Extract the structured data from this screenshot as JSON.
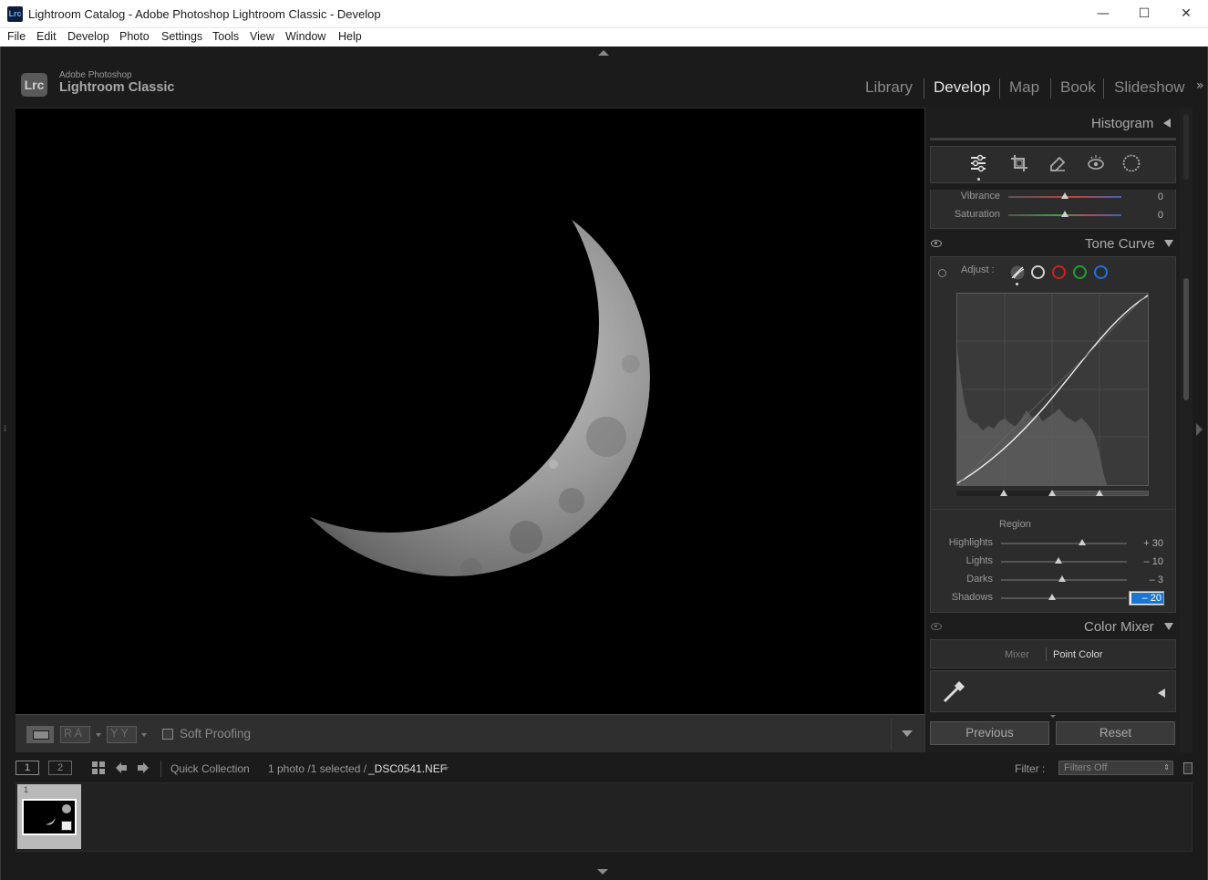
{
  "window": {
    "title": "Lightroom Catalog - Adobe Photoshop Lightroom Classic - Develop",
    "app_icon": "Lrc",
    "minimize": "—",
    "maximize": "☐",
    "close": "✕"
  },
  "menu": [
    "File",
    "Edit",
    "Develop",
    "Photo",
    "Settings",
    "Tools",
    "View",
    "Window",
    "Help"
  ],
  "identity": {
    "badge": "Lrc",
    "brand_top": "Adobe Photoshop",
    "brand_main": "Lightroom Classic"
  },
  "modules": [
    "Library",
    "Develop",
    "Map",
    "Book",
    "Slideshow"
  ],
  "active_module": "Develop",
  "toolbar": {
    "ra_label": "R A",
    "yy_label": "Y Y",
    "soft_proofing": "Soft Proofing"
  },
  "panels": {
    "histogram": "Histogram",
    "tone_curve": "Tone Curve",
    "color_mixer": "Color Mixer"
  },
  "tools": [
    "edit-sliders-icon",
    "crop-icon",
    "healing-icon",
    "red-eye-icon",
    "masking-icon"
  ],
  "basic_tail": [
    {
      "label": "Vibrance",
      "value": "0",
      "position": 0.5
    },
    {
      "label": "Saturation",
      "value": "0",
      "position": 0.5
    }
  ],
  "tone_curve": {
    "adjust_label": "Adjust :",
    "channel_colors": [
      "#cfcfcf",
      "#d02020",
      "#20a030",
      "#2070e0"
    ],
    "region_label": "Region",
    "region": [
      {
        "label": "Highlights",
        "value": "+ 30",
        "position": 0.65
      },
      {
        "label": "Lights",
        "value": "– 10",
        "position": 0.45
      },
      {
        "label": "Darks",
        "value": "– 3",
        "position": 0.485
      },
      {
        "label": "Shadows",
        "value": "– 20",
        "position": 0.4
      }
    ],
    "split_points": [
      0.25,
      0.5,
      0.75
    ]
  },
  "color_mixer": {
    "tabs": [
      "Mixer",
      "Point Color"
    ],
    "active_tab": "Point Color"
  },
  "buttons": {
    "previous": "Previous",
    "reset": "Reset"
  },
  "filmstrip": {
    "view1": "1",
    "view2": "2",
    "source": "Quick Collection",
    "count": "1 photo /1 selected /",
    "filename": "_DSC0541.NEF",
    "filter_label": "Filter :",
    "filter_value": "Filters Off",
    "thumb_index": "1"
  }
}
